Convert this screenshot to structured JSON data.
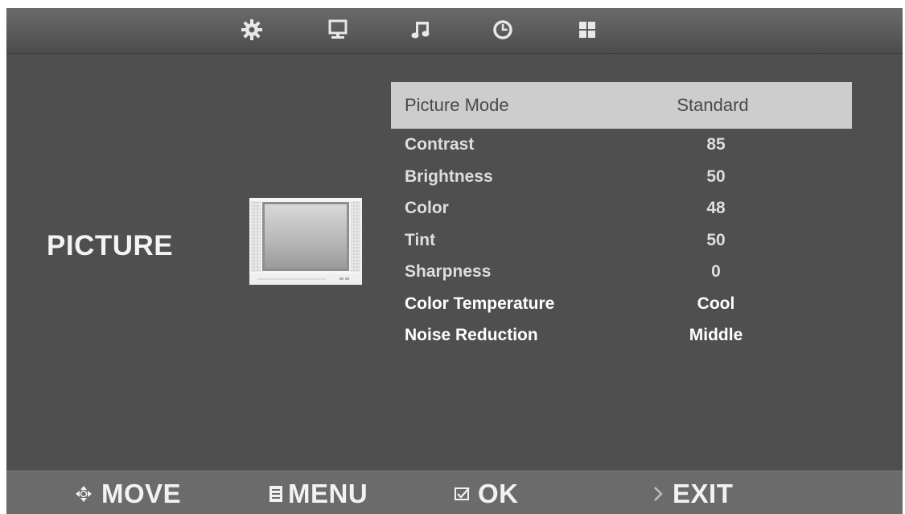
{
  "top_tabs": [
    {
      "icon": "gear-icon"
    },
    {
      "icon": "monitor-icon"
    },
    {
      "icon": "music-note-icon"
    },
    {
      "icon": "clock-icon"
    },
    {
      "icon": "grid-icon"
    }
  ],
  "section": {
    "title": "PICTURE"
  },
  "menu": {
    "items": [
      {
        "label": "Picture Mode",
        "value": "Standard",
        "selected": true
      },
      {
        "label": "Contrast",
        "value": "85"
      },
      {
        "label": "Brightness",
        "value": "50"
      },
      {
        "label": "Color",
        "value": "48"
      },
      {
        "label": "Tint",
        "value": "50"
      },
      {
        "label": "Sharpness",
        "value": "0"
      },
      {
        "label": "Color Temperature",
        "value": "Cool"
      },
      {
        "label": "Noise Reduction",
        "value": "Middle"
      }
    ]
  },
  "bottom_hints": {
    "move": "MOVE",
    "menu": "MENU",
    "ok": "OK",
    "exit": "EXIT"
  },
  "colors": {
    "background": "#4f4f4f",
    "highlight": "#cdcdcd",
    "bar": "#6b6b6b"
  }
}
